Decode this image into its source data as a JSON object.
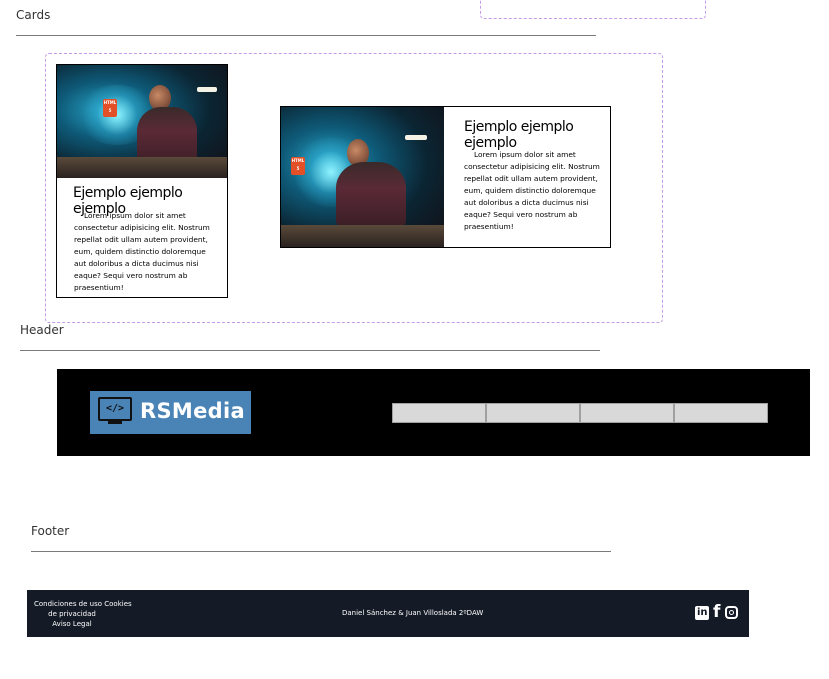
{
  "sections": {
    "cards_label": "Cards",
    "header_label": "Header",
    "footer_label": "Footer"
  },
  "cards": {
    "vertical": {
      "title": "Ejemplo ejemplo ejemplo",
      "text": "Lorem ipsum dolor sit amet consectetur adipisicing elit. Nostrum repellat odit ullam autem provident, eum, quidem distinctio doloremque aut doloribus a dicta ducimus nisi eaque? Sequi vero nostrum ab praesentium!"
    },
    "horizontal": {
      "title": "Ejemplo ejemplo ejemplo",
      "text": "Lorem ipsum dolor sit amet consectetur adipisicing elit. Nostrum repellat odit ullam autem provident, eum, quidem distinctio doloremque aut doloribus a dicta ducimus nisi eaque? Sequi vero nostrum ab praesentium!"
    },
    "image_badge": "HTML"
  },
  "header": {
    "logo_icon_text": "</>",
    "logo_text": "RSMedia",
    "logo_bg": "#4a83b5",
    "nav_items": [
      "",
      "",
      "",
      ""
    ]
  },
  "footer": {
    "links_line1": "Condiciones de uso Cookies",
    "links_line2": "de privacidad",
    "links_line3": "Aviso Legal",
    "credits": "Daniel Sánchez & Juan Villoslada 2ºDAW",
    "social_icons": [
      "linkedin-icon",
      "facebook-icon",
      "instagram-icon"
    ],
    "bg": "#141a26"
  },
  "colors": {
    "header_bg": "#000000",
    "dashed_border": "#c39be8"
  }
}
